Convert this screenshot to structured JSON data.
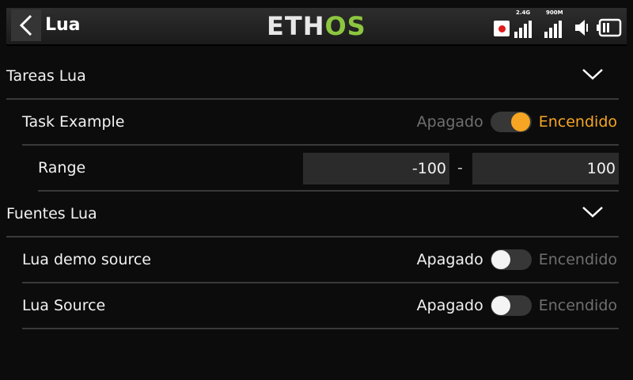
{
  "header": {
    "title": "Lua",
    "logo_eth": "ETH",
    "logo_os": "OS",
    "rf_internal_label": "2.4G",
    "rf_external_label": "900M"
  },
  "sections": [
    {
      "title": "Tareas Lua",
      "items": [
        {
          "label": "Task Example",
          "off_label": "Apagado",
          "on_label": "Encendido",
          "state": "on"
        }
      ],
      "range": {
        "label": "Range",
        "min": "-100",
        "separator": "-",
        "max": "100"
      }
    },
    {
      "title": "Fuentes Lua",
      "items": [
        {
          "label": "Lua demo source",
          "off_label": "Apagado",
          "on_label": "Encendido",
          "state": "off"
        },
        {
          "label": "Lua Source",
          "off_label": "Apagado",
          "on_label": "Encendido",
          "state": "off"
        }
      ]
    }
  ],
  "colors": {
    "accent": "#f6a623",
    "logo_green": "#8cc63f",
    "record": "#e01c1c"
  }
}
